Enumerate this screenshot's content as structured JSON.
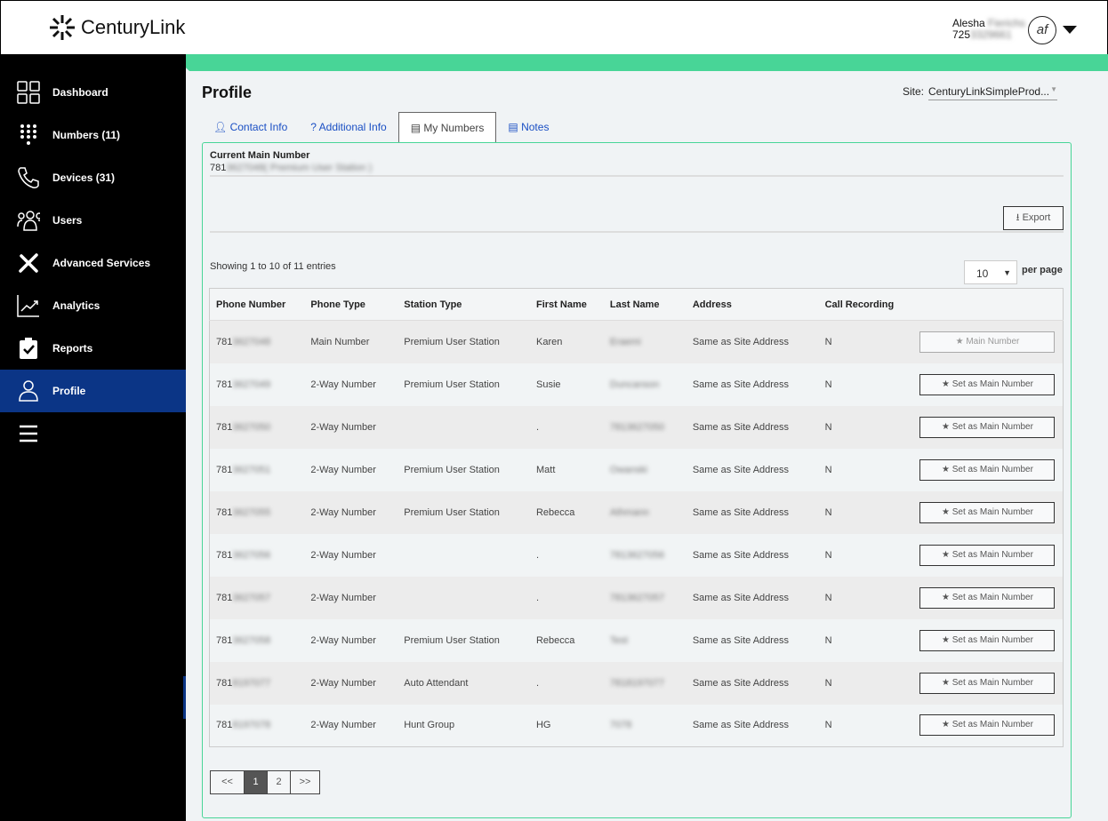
{
  "header": {
    "brand": "CenturyLink",
    "user_first": "Alesha",
    "user_last": "Fierichs",
    "user_phone_prefix": "725",
    "user_phone_rest": "3329661",
    "avatar_initials": "af"
  },
  "sidebar": {
    "items": [
      {
        "label": "Dashboard",
        "icon": "grid-icon"
      },
      {
        "label": "Numbers (11)",
        "icon": "dialpad-icon"
      },
      {
        "label": "Devices (31)",
        "icon": "phone-icon"
      },
      {
        "label": "Users",
        "icon": "users-icon"
      },
      {
        "label": "Advanced Services",
        "icon": "tools-icon"
      },
      {
        "label": "Analytics",
        "icon": "chart-icon"
      },
      {
        "label": "Reports",
        "icon": "clipboard-icon"
      },
      {
        "label": "Profile",
        "icon": "user-icon",
        "active": true
      }
    ]
  },
  "page": {
    "title": "Profile",
    "site_label": "Site:",
    "site_value": "CenturyLinkSimpleProd..."
  },
  "tabs": [
    {
      "label": "Contact Info"
    },
    {
      "label": "? Additional Info"
    },
    {
      "label": "My Numbers",
      "active": true
    },
    {
      "label": "Notes"
    }
  ],
  "current_main": {
    "label": "Current Main Number",
    "prefix": "781",
    "rest": "3627048( Premium User Station )"
  },
  "export_label": "Export",
  "showing": "Showing 1 to 10 of 11 entries",
  "per_page": {
    "value": "10",
    "label": "per page"
  },
  "table": {
    "headers": [
      "Phone Number",
      "Phone Type",
      "Station Type",
      "First Name",
      "Last Name",
      "Address",
      "Call Recording",
      ""
    ],
    "rows": [
      {
        "prefix": "781",
        "rest": "3627048",
        "type": "Main Number",
        "station": "Premium User Station",
        "first": "Karen",
        "last": "Eraemi",
        "address": "Same as Site Address",
        "rec": "N",
        "action": "Main Number",
        "is_main": true
      },
      {
        "prefix": "781",
        "rest": "3627049",
        "type": "2-Way Number",
        "station": "Premium User Station",
        "first": "Susie",
        "last": "Duncanson",
        "address": "Same as Site Address",
        "rec": "N",
        "action": "Set as Main Number"
      },
      {
        "prefix": "781",
        "rest": "3627050",
        "type": "2-Way Number",
        "station": "",
        "first": ".",
        "last": "7813627050",
        "address": "Same as Site Address",
        "rec": "N",
        "action": "Set as Main Number"
      },
      {
        "prefix": "781",
        "rest": "3627051",
        "type": "2-Way Number",
        "station": "Premium User Station",
        "first": "Matt",
        "last": "Owanski",
        "address": "Same as Site Address",
        "rec": "N",
        "action": "Set as Main Number"
      },
      {
        "prefix": "781",
        "rest": "3627055",
        "type": "2-Way Number",
        "station": "Premium User Station",
        "first": "Rebecca",
        "last": "Athmann",
        "address": "Same as Site Address",
        "rec": "N",
        "action": "Set as Main Number"
      },
      {
        "prefix": "781",
        "rest": "3627056",
        "type": "2-Way Number",
        "station": "",
        "first": ".",
        "last": "7813627056",
        "address": "Same as Site Address",
        "rec": "N",
        "action": "Set as Main Number"
      },
      {
        "prefix": "781",
        "rest": "3627057",
        "type": "2-Way Number",
        "station": "",
        "first": ".",
        "last": "7813627057",
        "address": "Same as Site Address",
        "rec": "N",
        "action": "Set as Main Number"
      },
      {
        "prefix": "781",
        "rest": "3627058",
        "type": "2-Way Number",
        "station": "Premium User Station",
        "first": "Rebecca",
        "last": "Test",
        "address": "Same as Site Address",
        "rec": "N",
        "action": "Set as Main Number"
      },
      {
        "prefix": "781",
        "rest": "8197077",
        "type": "2-Way Number",
        "station": "Auto Attendant",
        "first": ".",
        "last": "7818197077",
        "address": "Same as Site Address",
        "rec": "N",
        "action": "Set as Main Number"
      },
      {
        "prefix": "781",
        "rest": "8197078",
        "type": "2-Way Number",
        "station": "Hunt Group",
        "first": "HG",
        "last": "7078",
        "address": "Same as Site Address",
        "rec": "N",
        "action": "Set as Main Number"
      }
    ]
  },
  "pagination": {
    "prev": "<<",
    "pages": [
      "1",
      "2"
    ],
    "current": "1",
    "next": ">>"
  },
  "colors": {
    "accent_green": "#48d597",
    "nav_active": "#0b3586",
    "link": "#1a4fc4"
  }
}
